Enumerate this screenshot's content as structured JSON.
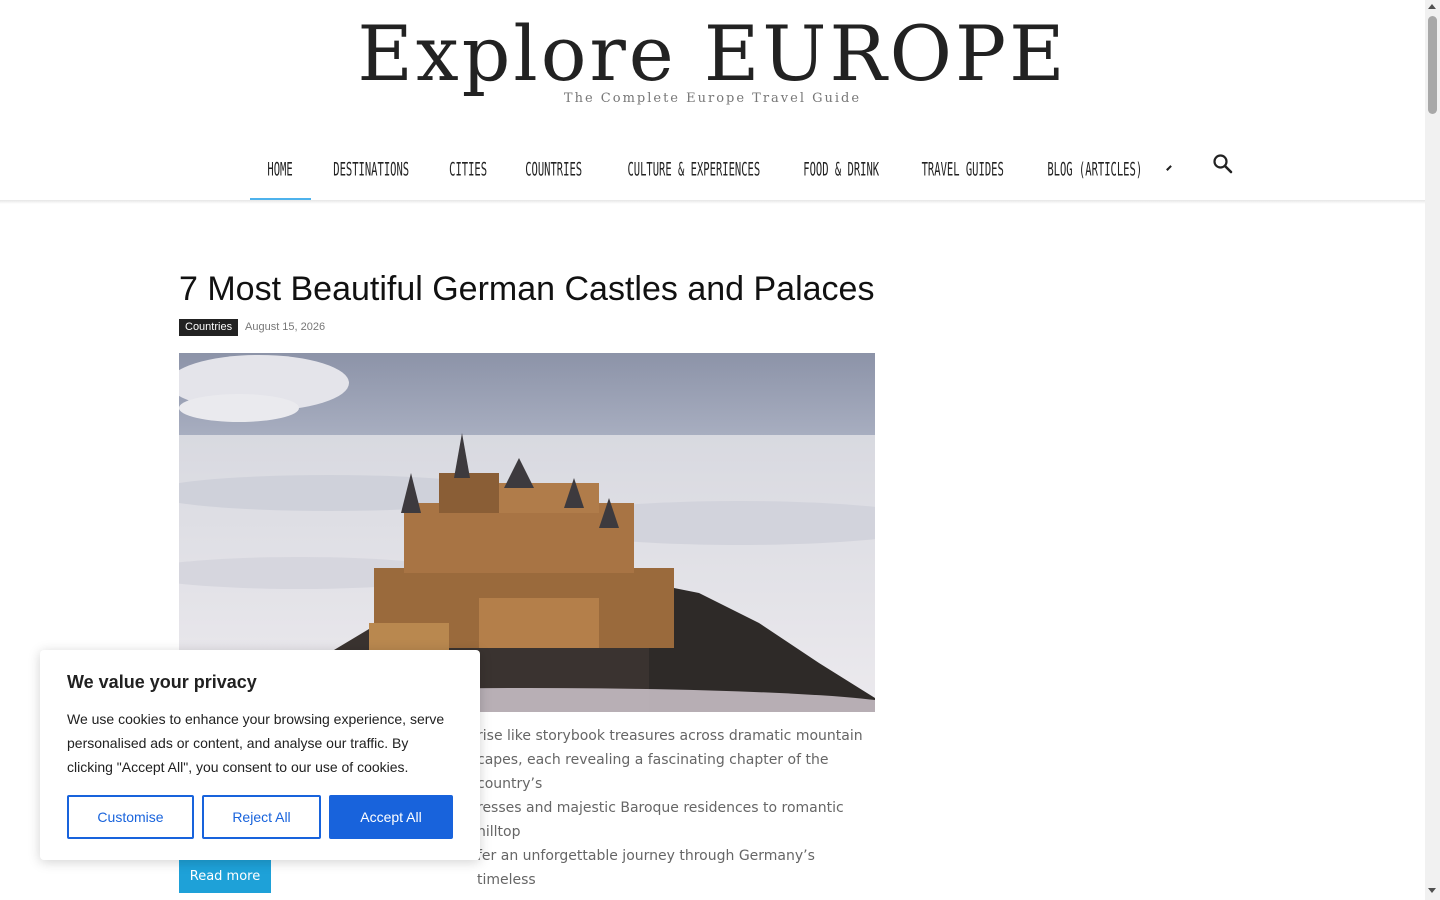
{
  "header": {
    "logo": "Explore EUROPE",
    "tagline": "The Complete Europe Travel Guide"
  },
  "nav": {
    "items": [
      {
        "label": "Home",
        "active": true
      },
      {
        "label": "Destinations"
      },
      {
        "label": "Cities"
      },
      {
        "label": "Countries"
      },
      {
        "label": "Culture & Experiences"
      },
      {
        "label": "Food & Drink"
      },
      {
        "label": "Travel Guides"
      },
      {
        "label": "Blog (Articles)",
        "has_dropdown": true
      }
    ],
    "search_icon": "search-icon",
    "accent_color": "#4db2ec"
  },
  "article": {
    "title": "7 Most Beautiful German Castles and Palaces",
    "category": "Countries",
    "date": "August 15, 2026",
    "excerpt_lines": [
      "rise like storybook treasures across dramatic mountain",
      "capes, each revealing a fascinating chapter of the country’s",
      "resses and majestic Baroque residences to romantic hilltop",
      "fer an unforgettable journey through Germany’s timeless"
    ],
    "read_more": "Read more",
    "read_more_color": "#1ea1d8"
  },
  "cookie": {
    "title": "We value your privacy",
    "text": "We use cookies to enhance your browsing experience, serve personalised ads or content, and analyse our traffic. By clicking \"Accept All\", you consent to our use of cookies.",
    "customise": "Customise",
    "reject": "Reject All",
    "accept": "Accept All",
    "brand_color": "#1863dc"
  }
}
